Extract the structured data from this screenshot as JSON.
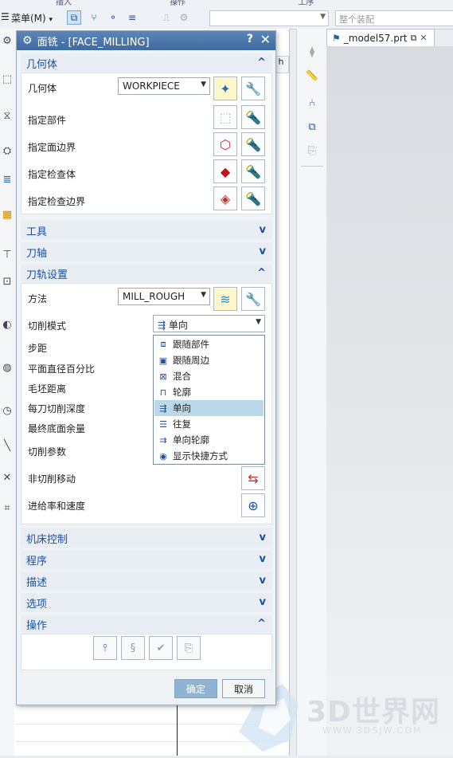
{
  "toolbar": {
    "ribbon_labels": [
      "插入",
      "操作",
      "工序"
    ],
    "menu_label": "菜单(M)",
    "group_combo_placeholder": "整个装配"
  },
  "navigator": {
    "tab_stub": "h"
  },
  "model_tab": {
    "title": "_model57.prt",
    "pin_glyph": "⧉",
    "close_glyph": "✕"
  },
  "watermark": {
    "text": "3D世界网",
    "url": "WWW.3DSJW.COM"
  },
  "dialog": {
    "title": "面铣 - [FACE_MILLING]",
    "help": "?",
    "close": "✕",
    "sections": {
      "geometry": {
        "header": "几何体",
        "geometry_label": "几何体",
        "geometry_value": "WORKPIECE",
        "specify_part": "指定部件",
        "specify_face_boundary": "指定面边界",
        "specify_check_body": "指定检查体",
        "specify_check_boundary": "指定检查边界"
      },
      "tools": {
        "header": "工具"
      },
      "tool_axis": {
        "header": "刀轴"
      },
      "path_settings": {
        "header": "刀轨设置",
        "method_label": "方法",
        "method_value": "MILL_ROUGH",
        "cut_pattern_label": "切削模式",
        "cut_pattern_value": "单向",
        "stepover": "步距",
        "flat_diameter_percent": "平面直径百分比",
        "blank_distance": "毛坯距离",
        "depth_per_cut": "每刀切削深度",
        "final_floor_stock": "最终底面余量",
        "cut_parameters": "切削参数",
        "non_cutting_moves": "非切削移动",
        "feeds_speeds": "进给率和速度"
      },
      "machine_control": {
        "header": "机床控制"
      },
      "program": {
        "header": "程序"
      },
      "description": {
        "header": "描述"
      },
      "options": {
        "header": "选项"
      },
      "actions": {
        "header": "操作"
      }
    },
    "cut_pattern_options": [
      {
        "label": "跟随部件",
        "icon": "follow-part-icon",
        "glyph": "⧈",
        "selected": false
      },
      {
        "label": "跟随周边",
        "icon": "follow-periphery-icon",
        "glyph": "▣",
        "selected": false
      },
      {
        "label": "混合",
        "icon": "mixed-icon",
        "glyph": "⊠",
        "selected": false
      },
      {
        "label": "轮廓",
        "icon": "profile-icon",
        "glyph": "⊓",
        "selected": false
      },
      {
        "label": "单向",
        "icon": "zig-icon",
        "glyph": "⇶",
        "selected": true
      },
      {
        "label": "往复",
        "icon": "zig-zag-icon",
        "glyph": "☰",
        "selected": false
      },
      {
        "label": "单向轮廓",
        "icon": "zig-with-contour-icon",
        "glyph": "⇉",
        "selected": false
      },
      {
        "label": "显示快捷方式",
        "icon": "eye-icon",
        "glyph": "◉",
        "selected": false
      }
    ],
    "ok_label": "确定",
    "cancel_label": "取消"
  },
  "colors": {
    "accent": "#1b4f9e",
    "title_bar": "#4a74aa",
    "selected_row": "#b9d9ea",
    "ok_button": "#8fb3d3"
  }
}
